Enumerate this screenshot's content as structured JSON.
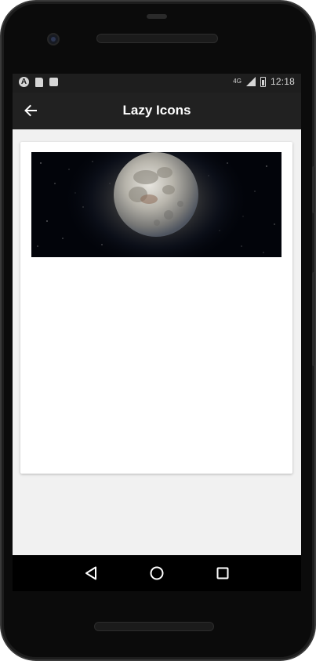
{
  "app": {
    "title": "Lazy Icons"
  },
  "status_bar": {
    "time": "12:18",
    "network_label": "4G"
  },
  "icons": {
    "back": "arrow-back-icon",
    "nav_back": "triangle-back-icon",
    "nav_home": "circle-home-icon",
    "nav_recents": "square-recents-icon"
  },
  "colors": {
    "app_bar": "#212121",
    "status_bar": "#1e1e1e",
    "screen_bg": "#f1f1f1",
    "card_bg": "#ffffff"
  }
}
